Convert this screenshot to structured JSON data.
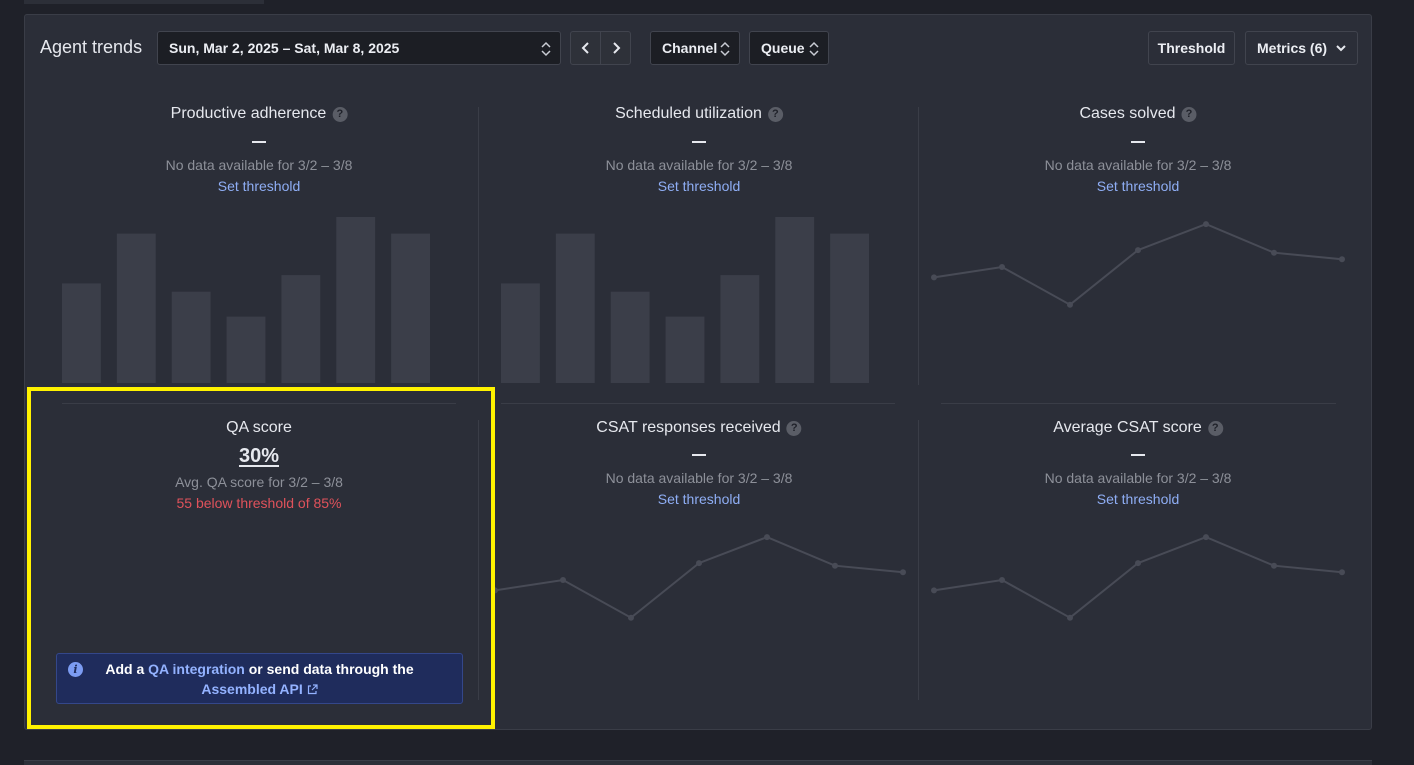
{
  "header": {
    "title": "Agent trends",
    "date_range": "Sun, Mar 2, 2025 – Sat, Mar 8, 2025",
    "channel_label": "Channel",
    "queue_label": "Queue",
    "threshold_label": "Threshold",
    "metrics_label": "Metrics (6)"
  },
  "icons": {
    "prev": "chevron-left-icon",
    "next": "chevron-right-icon",
    "updown": "chevron-up-down-icon",
    "dropdown": "chevron-down-icon",
    "help": "question-mark-icon",
    "info": "info-icon",
    "external": "external-link-icon"
  },
  "cards": {
    "productive_adherence": {
      "title": "Productive adherence",
      "value": "—",
      "status": "No data available for 3/2 – 3/8",
      "link": "Set threshold"
    },
    "scheduled_utilization": {
      "title": "Scheduled utilization",
      "value": "—",
      "status": "No data available for 3/2 – 3/8",
      "link": "Set threshold"
    },
    "cases_solved": {
      "title": "Cases solved",
      "value": "—",
      "status": "No data available for 3/2 – 3/8",
      "link": "Set threshold"
    },
    "qa_score": {
      "title": "QA score",
      "value": "30%",
      "subtitle": "Avg. QA score for 3/2 – 3/8",
      "warning": "55 below threshold of 85%",
      "banner_prefix": "Add a ",
      "banner_link": "QA integration",
      "banner_middle": " or send data through the",
      "banner_api_link": "Assembled API"
    },
    "csat_responses": {
      "title": "CSAT responses received",
      "value": "—",
      "status": "No data available for 3/2 – 3/8",
      "link": "Set threshold"
    },
    "avg_csat": {
      "title": "Average CSAT score",
      "value": "—",
      "status": "No data available for 3/2 – 3/8",
      "link": "Set threshold"
    }
  },
  "chart_data": [
    {
      "type": "bar",
      "title": "Productive adherence",
      "placeholder": true,
      "values": [
        6,
        9,
        5.5,
        4,
        6.5,
        10,
        9
      ],
      "ylim": [
        0,
        10
      ]
    },
    {
      "type": "bar",
      "title": "Scheduled utilization",
      "placeholder": true,
      "values": [
        6,
        9,
        5.5,
        4,
        6.5,
        10,
        9
      ],
      "ylim": [
        0,
        10
      ]
    },
    {
      "type": "line",
      "title": "Cases solved",
      "placeholder": true,
      "values": [
        5.2,
        6.0,
        3.1,
        7.3,
        9.3,
        7.1,
        6.6
      ],
      "ylim": [
        0,
        10
      ]
    },
    {
      "type": "line",
      "title": "CSAT responses received",
      "placeholder": true,
      "values": [
        5.2,
        6.0,
        3.1,
        7.3,
        9.3,
        7.1,
        6.6
      ],
      "ylim": [
        0,
        10
      ]
    },
    {
      "type": "line",
      "title": "Average CSAT score",
      "placeholder": true,
      "values": [
        5.2,
        6.0,
        3.1,
        7.3,
        9.3,
        7.1,
        6.6
      ],
      "ylim": [
        0,
        10
      ]
    }
  ]
}
